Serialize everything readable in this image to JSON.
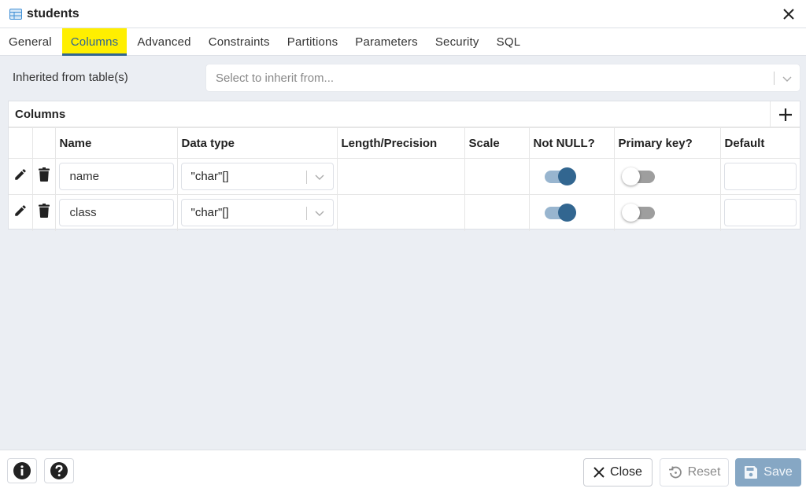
{
  "window": {
    "title": "students",
    "title_icon": "table-icon",
    "close_icon": "close-icon"
  },
  "tabs": [
    {
      "label": "General",
      "active": false
    },
    {
      "label": "Columns",
      "active": true
    },
    {
      "label": "Advanced",
      "active": false
    },
    {
      "label": "Constraints",
      "active": false
    },
    {
      "label": "Partitions",
      "active": false
    },
    {
      "label": "Parameters",
      "active": false
    },
    {
      "label": "Security",
      "active": false
    },
    {
      "label": "SQL",
      "active": false
    }
  ],
  "inherit": {
    "label": "Inherited from table(s)",
    "placeholder": "Select to inherit from...",
    "value": ""
  },
  "columns_grid": {
    "caption": "Columns",
    "add_icon": "plus-icon",
    "headers": [
      "",
      "",
      "Name",
      "Data type",
      "Length/Precision",
      "Scale",
      "Not NULL?",
      "Primary key?",
      "Default"
    ],
    "rows": [
      {
        "name": "name",
        "data_type": "\"char\"[]",
        "length": "",
        "scale": "",
        "not_null": true,
        "primary_key": false,
        "default": ""
      },
      {
        "name": "class",
        "data_type": "\"char\"[]",
        "length": "",
        "scale": "",
        "not_null": true,
        "primary_key": false,
        "default": ""
      }
    ]
  },
  "footer": {
    "info_icon": "info-icon",
    "help_icon": "help-icon",
    "close_label": "Close",
    "reset_label": "Reset",
    "save_label": "Save"
  },
  "colors": {
    "accent": "#326690",
    "tab_highlight": "#ffef00",
    "toggle_on_track": "#98b5cf",
    "toggle_off_track": "#9e9e9e",
    "save_disabled": "#86a7c4",
    "background": "#ebeef3"
  }
}
